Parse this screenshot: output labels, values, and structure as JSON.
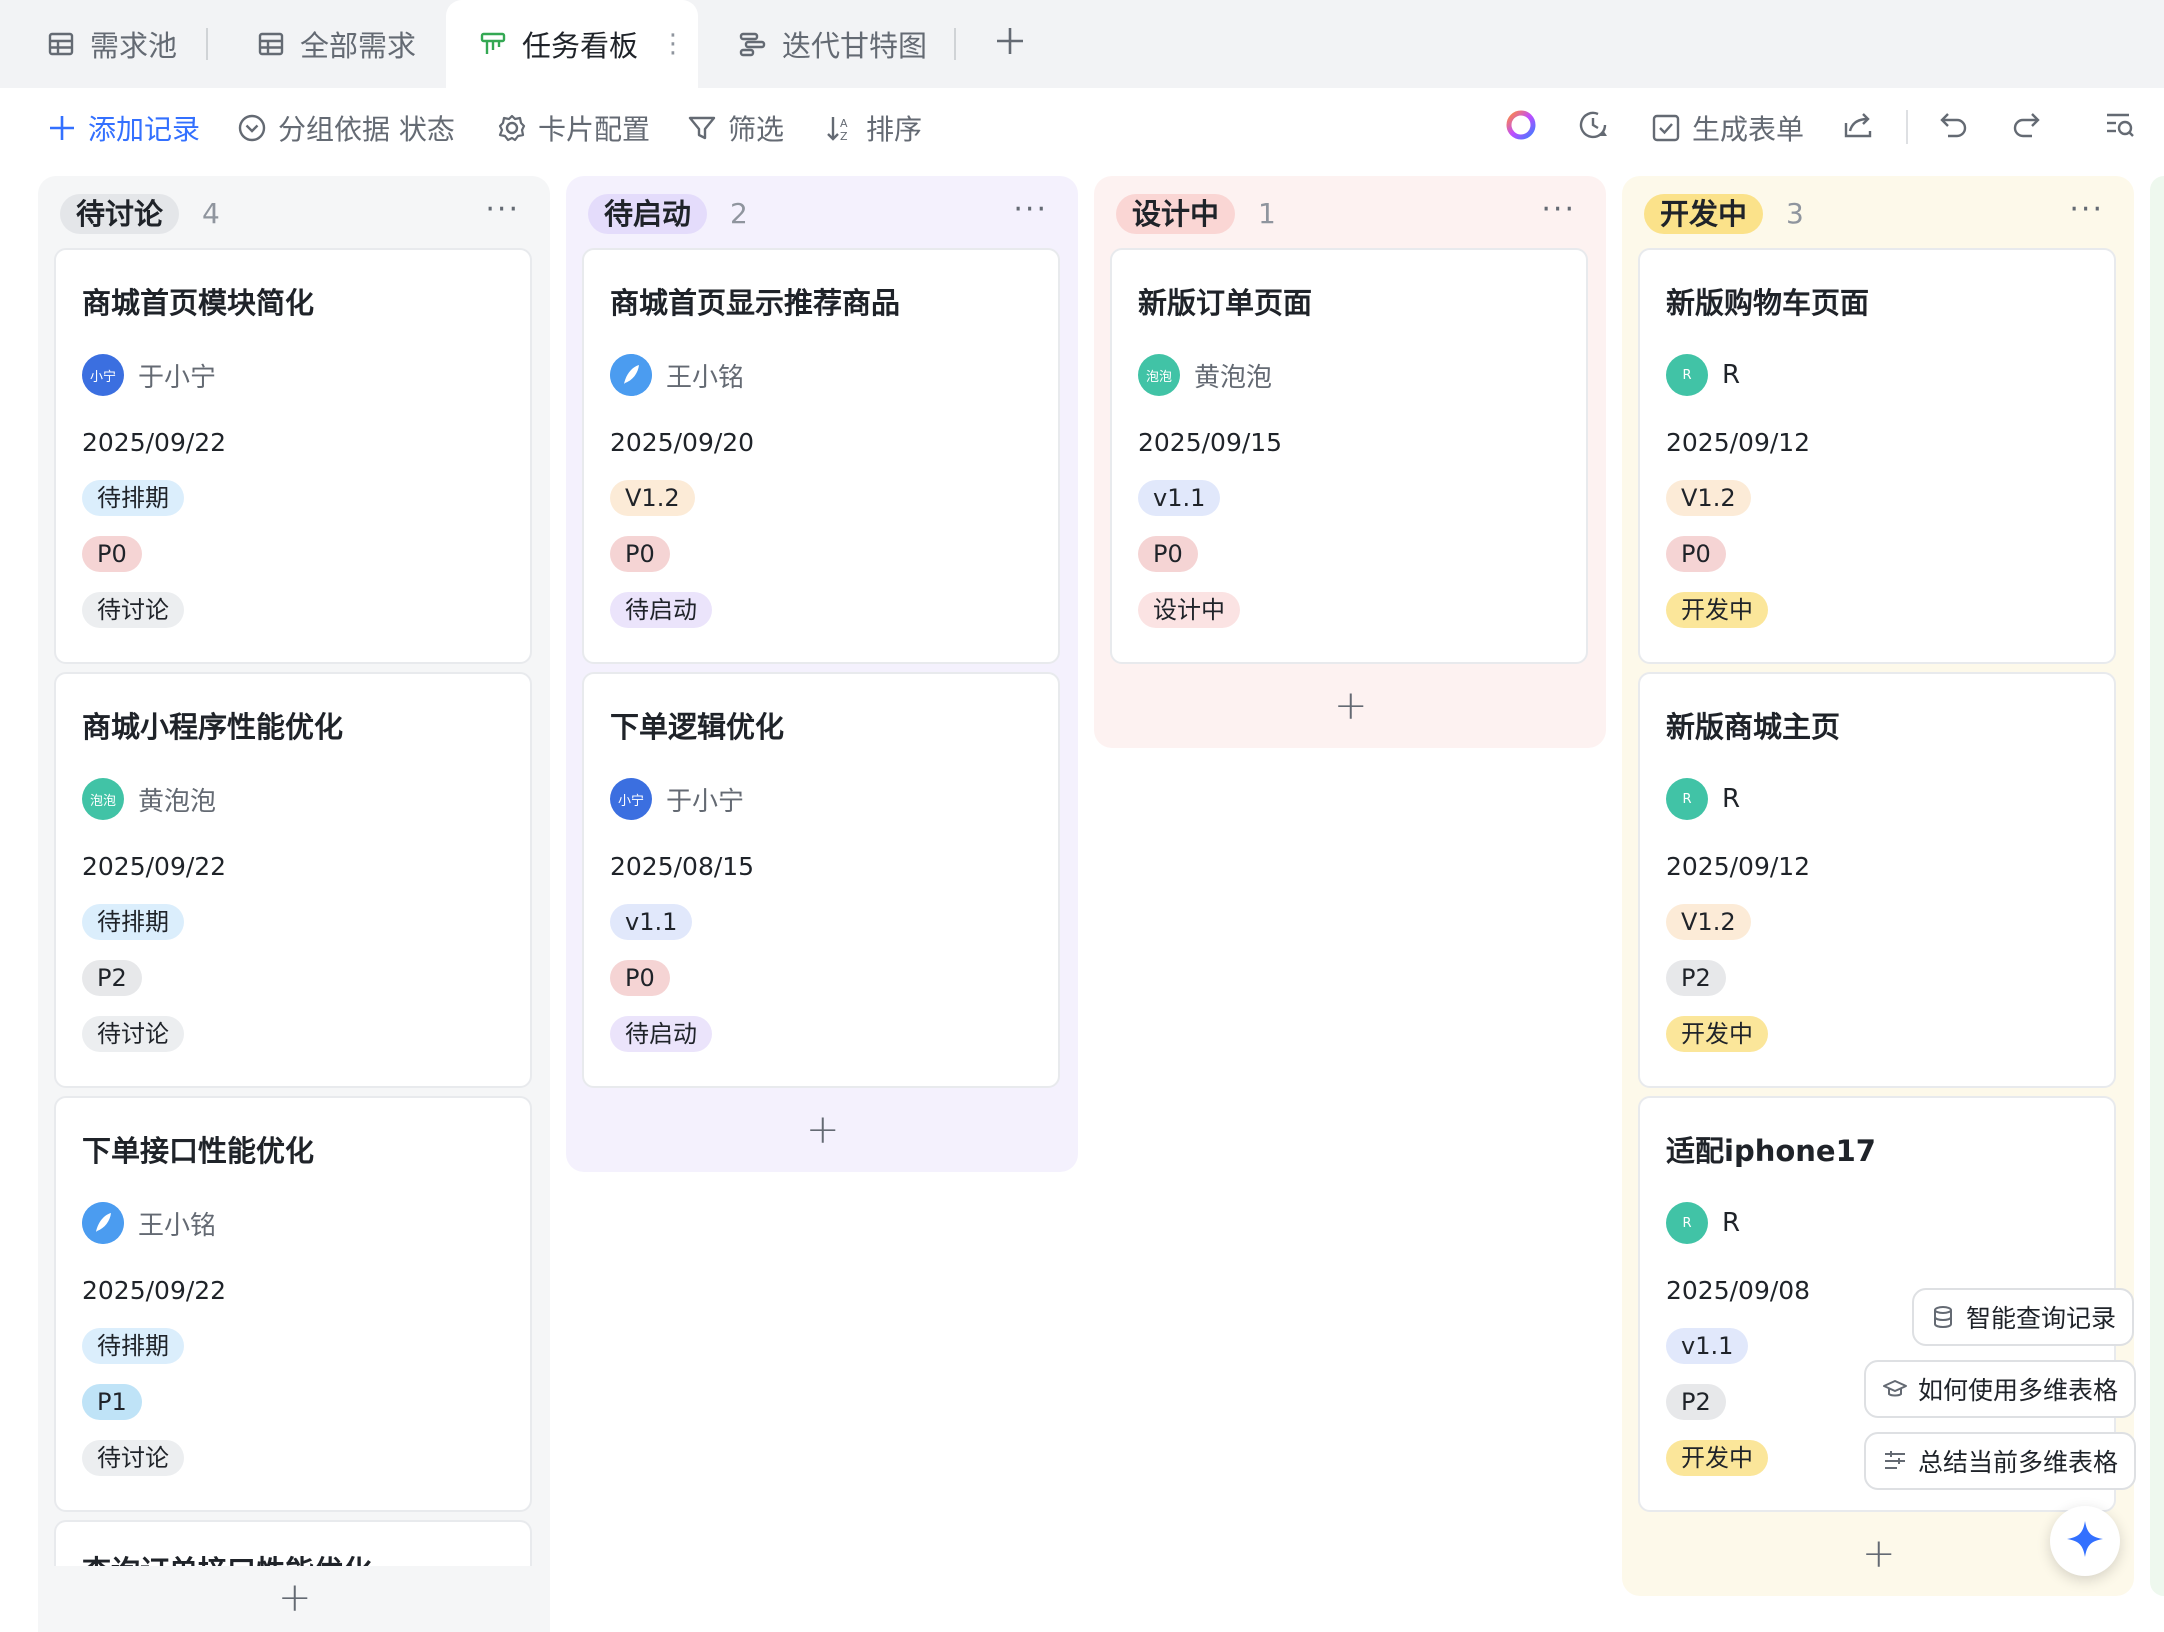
{
  "tabs": [
    {
      "label": "需求池",
      "icon": "grid-table-icon"
    },
    {
      "label": "全部需求",
      "icon": "grid-table-icon"
    },
    {
      "label": "任务看板",
      "icon": "kanban-icon",
      "more": "⋮"
    },
    {
      "label": "迭代甘特图",
      "icon": "gantt-icon"
    }
  ],
  "toolbar": {
    "add_record": "添加记录",
    "group_by": "分组依据 状态",
    "card_config": "卡片配置",
    "filter": "筛选",
    "sort": "排序",
    "generate_form": "生成表单"
  },
  "columns": [
    {
      "status": "待讨论",
      "count": "4",
      "more": "···",
      "cards": [
        {
          "title": "商城首页模块简化",
          "avatar_text": "小宁",
          "user": "于小宁",
          "date": "2025/09/22",
          "tags": [
            "待排期",
            "P0",
            "待讨论"
          ]
        },
        {
          "title": "商城小程序性能优化",
          "avatar_text": "泡泡",
          "user": "黄泡泡",
          "date": "2025/09/22",
          "tags": [
            "待排期",
            "P2",
            "待讨论"
          ]
        },
        {
          "title": "下单接口性能优化",
          "avatar_text": "",
          "user": "王小铭",
          "date": "2025/09/22",
          "tags": [
            "待排期",
            "P1",
            "待讨论"
          ]
        },
        {
          "title": "查询订单接口性能优化"
        }
      ]
    },
    {
      "status": "待启动",
      "count": "2",
      "more": "···",
      "cards": [
        {
          "title": "商城首页显示推荐商品",
          "avatar_text": "",
          "user": "王小铭",
          "date": "2025/09/20",
          "tags": [
            "V1.2",
            "P0",
            "待启动"
          ]
        },
        {
          "title": "下单逻辑优化",
          "avatar_text": "小宁",
          "user": "于小宁",
          "date": "2025/08/15",
          "tags": [
            "v1.1",
            "P0",
            "待启动"
          ]
        }
      ]
    },
    {
      "status": "设计中",
      "count": "1",
      "more": "···",
      "cards": [
        {
          "title": "新版订单页面",
          "avatar_text": "泡泡",
          "user": "黄泡泡",
          "date": "2025/09/15",
          "tags": [
            "v1.1",
            "P0",
            "设计中"
          ]
        }
      ]
    },
    {
      "status": "开发中",
      "count": "3",
      "more": "···",
      "cards": [
        {
          "title": "新版购物车页面",
          "avatar_text": "R",
          "user": "R",
          "date": "2025/09/12",
          "tags": [
            "V1.2",
            "P0",
            "开发中"
          ]
        },
        {
          "title": "新版商城主页",
          "avatar_text": "R",
          "user": "R",
          "date": "2025/09/12",
          "tags": [
            "V1.2",
            "P2",
            "开发中"
          ]
        },
        {
          "title": "适配iphone17",
          "avatar_text": "R",
          "user": "R",
          "date": "2025/09/08",
          "tags": [
            "v1.1",
            "P2",
            "开发中"
          ]
        }
      ]
    }
  ],
  "add_symbol": "+",
  "assistant": {
    "smart_query": "智能查询记录",
    "how_to_use": "如何使用多维表格",
    "summarize": "总结当前多维表格"
  },
  "colors": {
    "accent": "#3370ff",
    "col_discuss_bg": "#f5f6f7",
    "col_start_bg": "#f4f1fd",
    "col_design_bg": "#fdf2f1",
    "col_dev_bg": "#fdf9ea",
    "tag_schedule": "#dbeefc",
    "tag_p0": "#f5d4d4",
    "tag_p1": "#bfe3f7",
    "tag_p2": "#e7e8ea",
    "tag_v12": "#fcebd7",
    "tag_v11": "#e1e8fb",
    "tag_discuss": "#eceef0",
    "tag_start": "#ebe4fb",
    "tag_design": "#fbe3e3",
    "tag_dev": "#fbe69a"
  }
}
